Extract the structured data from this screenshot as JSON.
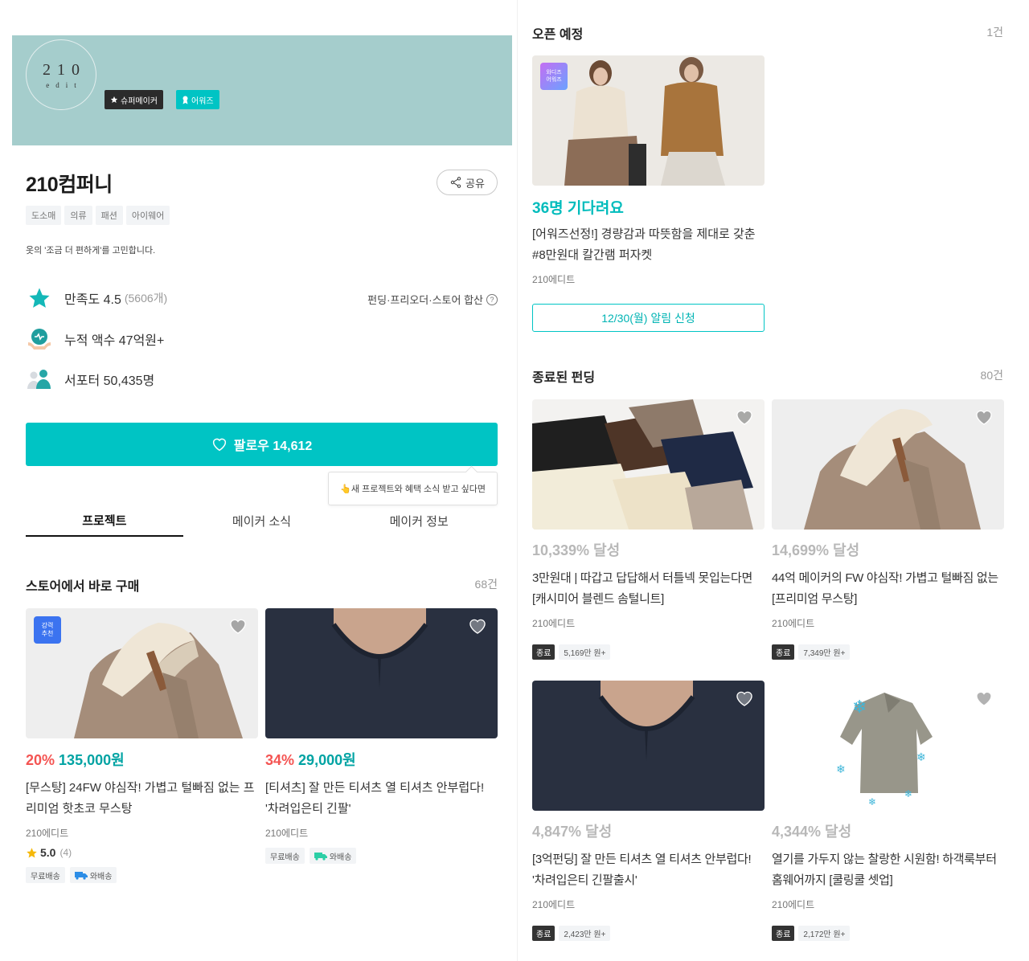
{
  "maker": {
    "logo_line1": "210",
    "logo_line2": "edit",
    "badge_super": "슈퍼메이커",
    "badge_award": "어워즈",
    "name": "210컴퍼니",
    "share_label": "공유",
    "tags": [
      "도소매",
      "의류",
      "패션",
      "아이웨어"
    ],
    "intro": "옷의 '조금 더 편하게'를 고민합니다.",
    "satisfaction_label": "만족도 4.5",
    "satisfaction_count": "(5606개)",
    "stats_note": "펀딩·프리오더·스토어 합산",
    "total_amount": "누적 액수 47억원+",
    "supporters": "서포터 50,435명",
    "follow_label": "팔로우 14,612",
    "tooltip": "👆새 프로젝트와 혜택 소식 받고 싶다면"
  },
  "colors": {
    "banner": "#a5cdcc",
    "accent": "#00c4c4",
    "discount": "#f45452"
  },
  "tabs": [
    {
      "label": "프로젝트",
      "active": true
    },
    {
      "label": "메이커 소식",
      "active": false
    },
    {
      "label": "메이커 정보",
      "active": false
    }
  ],
  "store": {
    "title": "스토어에서 바로 구매",
    "count": "68건",
    "items": [
      {
        "pick_badge": [
          "강력",
          "추천"
        ],
        "discount": "20%",
        "price": "135,000원",
        "name": "[무스탕] 24FW 야심작! 가볍고 털빠짐 없는 프리미엄 핫초코 무스탕",
        "maker": "210에디트",
        "rating": "5.0",
        "rating_count": "(4)",
        "shipping": [
          "무료배송",
          "와배송"
        ]
      },
      {
        "discount": "34%",
        "price": "29,000원",
        "name": "[티셔츠] 잘 만든 티셔츠 열 티셔츠 안부럽다! '차려입은티 긴팔'",
        "maker": "210에디트",
        "shipping": [
          "무료배송",
          "와배송"
        ]
      }
    ]
  },
  "upcoming": {
    "title": "오픈 예정",
    "count": "1건",
    "item": {
      "badge": [
        "와디즈",
        "어워즈"
      ],
      "waiting": "36명 기다려요",
      "name": "[어워즈선정!] 경량감과 따뜻함을 제대로 갖춘 #8만원대 칼간램 퍼자켓",
      "maker": "210에디트",
      "notify_label": "12/30(월) 알림 신청"
    }
  },
  "ended": {
    "title": "종료된 펀딩",
    "count": "80건",
    "items": [
      {
        "rate": "10,339% 달성",
        "name": "3만원대 | 따갑고 답답해서 터틀넥 못입는다면 [캐시미어 블렌드 솜털니트]",
        "maker": "210에디트",
        "status": "종료",
        "amount": "5,169만 원+"
      },
      {
        "rate": "14,699% 달성",
        "name": "44억 메이커의 FW 야심작! 가볍고 털빠짐 없는 [프리미엄 무스탕]",
        "maker": "210에디트",
        "status": "종료",
        "amount": "7,349만 원+"
      },
      {
        "rate": "4,847% 달성",
        "name": "[3억펀딩] 잘 만든 티셔츠 열 티셔츠 안부럽다! '차려입은티 긴팔출시'",
        "maker": "210에디트",
        "status": "종료",
        "amount": "2,423만 원+"
      },
      {
        "rate": "4,344% 달성",
        "name": "열기를 가두지 않는 찰랑한 시원함! 하객룩부터 홈웨어까지 [쿨링쿨 셋업]",
        "maker": "210에디트",
        "status": "종료",
        "amount": "2,172만 원+"
      }
    ]
  }
}
